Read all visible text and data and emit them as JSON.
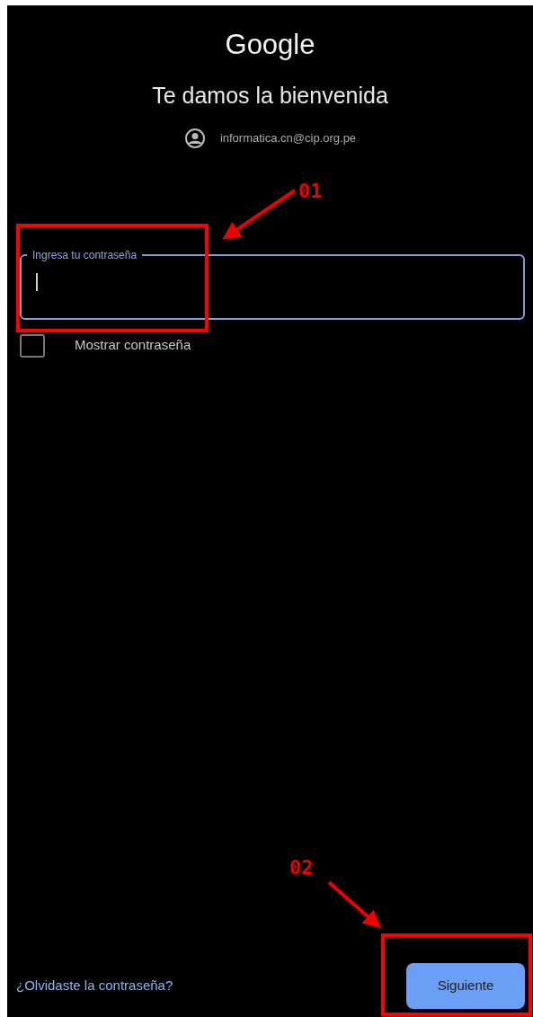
{
  "logo": "Google",
  "title": "Te damos la bienvenida",
  "account": {
    "email": "informatica.cn@cip.org.pe"
  },
  "password_field": {
    "label": "Ingresa tu contraseña",
    "focused": true
  },
  "show_password": {
    "label": "Mostrar contraseña",
    "checked": false
  },
  "forgot_link": "¿Olvidaste la contraseña?",
  "next_button": "Siguiente",
  "annotations": [
    {
      "label": "01"
    },
    {
      "label": "02"
    }
  ]
}
